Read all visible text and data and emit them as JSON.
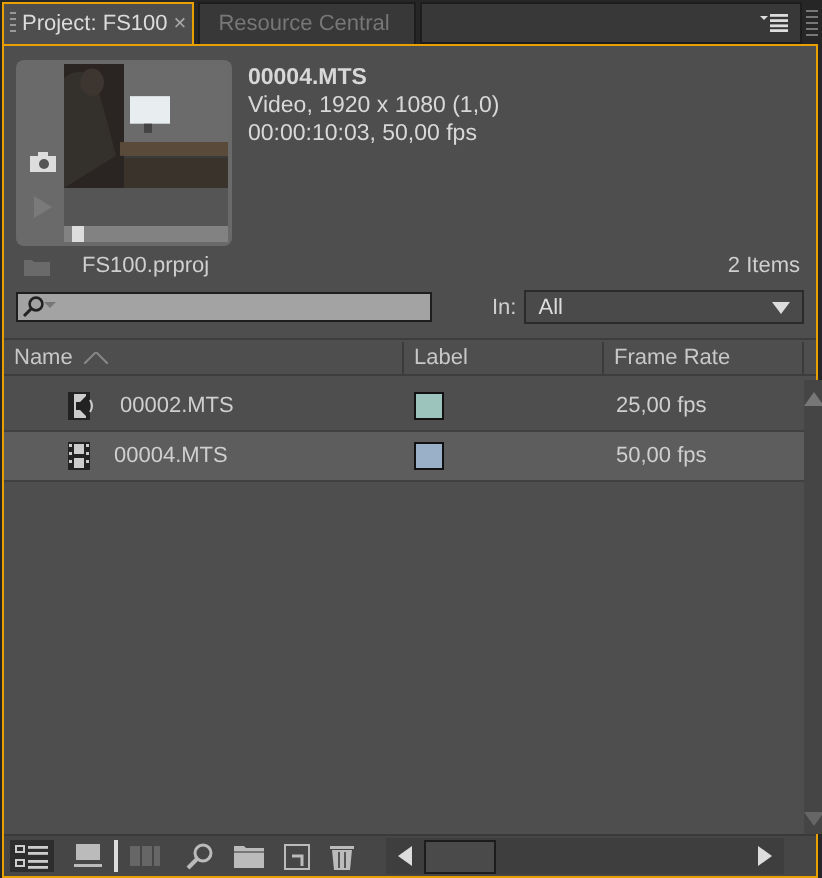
{
  "tabs": [
    {
      "label": "Project: FS100",
      "close": "×",
      "selected": true
    },
    {
      "label": "Resource Central",
      "selected": false
    }
  ],
  "preview": {
    "name": "00004.MTS",
    "details": [
      "Video, 1920 x 1080 (1,0)",
      "00:00:10:03, 50,00 fps"
    ],
    "level": 0.05
  },
  "project": {
    "file": "FS100.prproj",
    "count": "2 Items"
  },
  "search": {
    "in_label": "In:",
    "in_value": "All"
  },
  "table": {
    "columns": [
      "Name",
      "Label",
      "Frame Rate"
    ],
    "rows": [
      {
        "kind": "audio-video",
        "name": "00002.MTS",
        "color": "#9cc4bc",
        "frame_rate": "25,00 fps",
        "selected": false
      },
      {
        "kind": "video",
        "name": "00004.MTS",
        "color": "#9ab0c8",
        "frame_rate": "50,00 fps",
        "selected": true
      }
    ]
  }
}
